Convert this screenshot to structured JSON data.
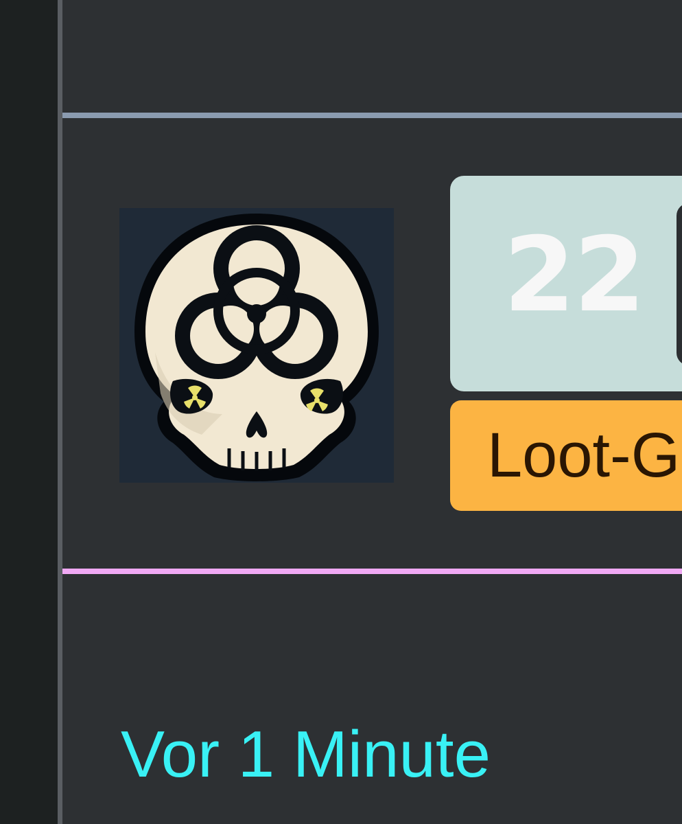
{
  "post": {
    "avatar_icon": "biohazard-skull-icon",
    "count": "22",
    "tag": "Loot-G",
    "timestamp": "Vor 1 Minute"
  },
  "colors": {
    "background": "#2d3033",
    "rail": "#1d2121",
    "divider_top": "#8a9bb0",
    "divider_bottom": "#f0a9f4",
    "count_card": "#c6ddda",
    "tag_badge": "#fcb443",
    "timestamp": "#39f1f5"
  }
}
